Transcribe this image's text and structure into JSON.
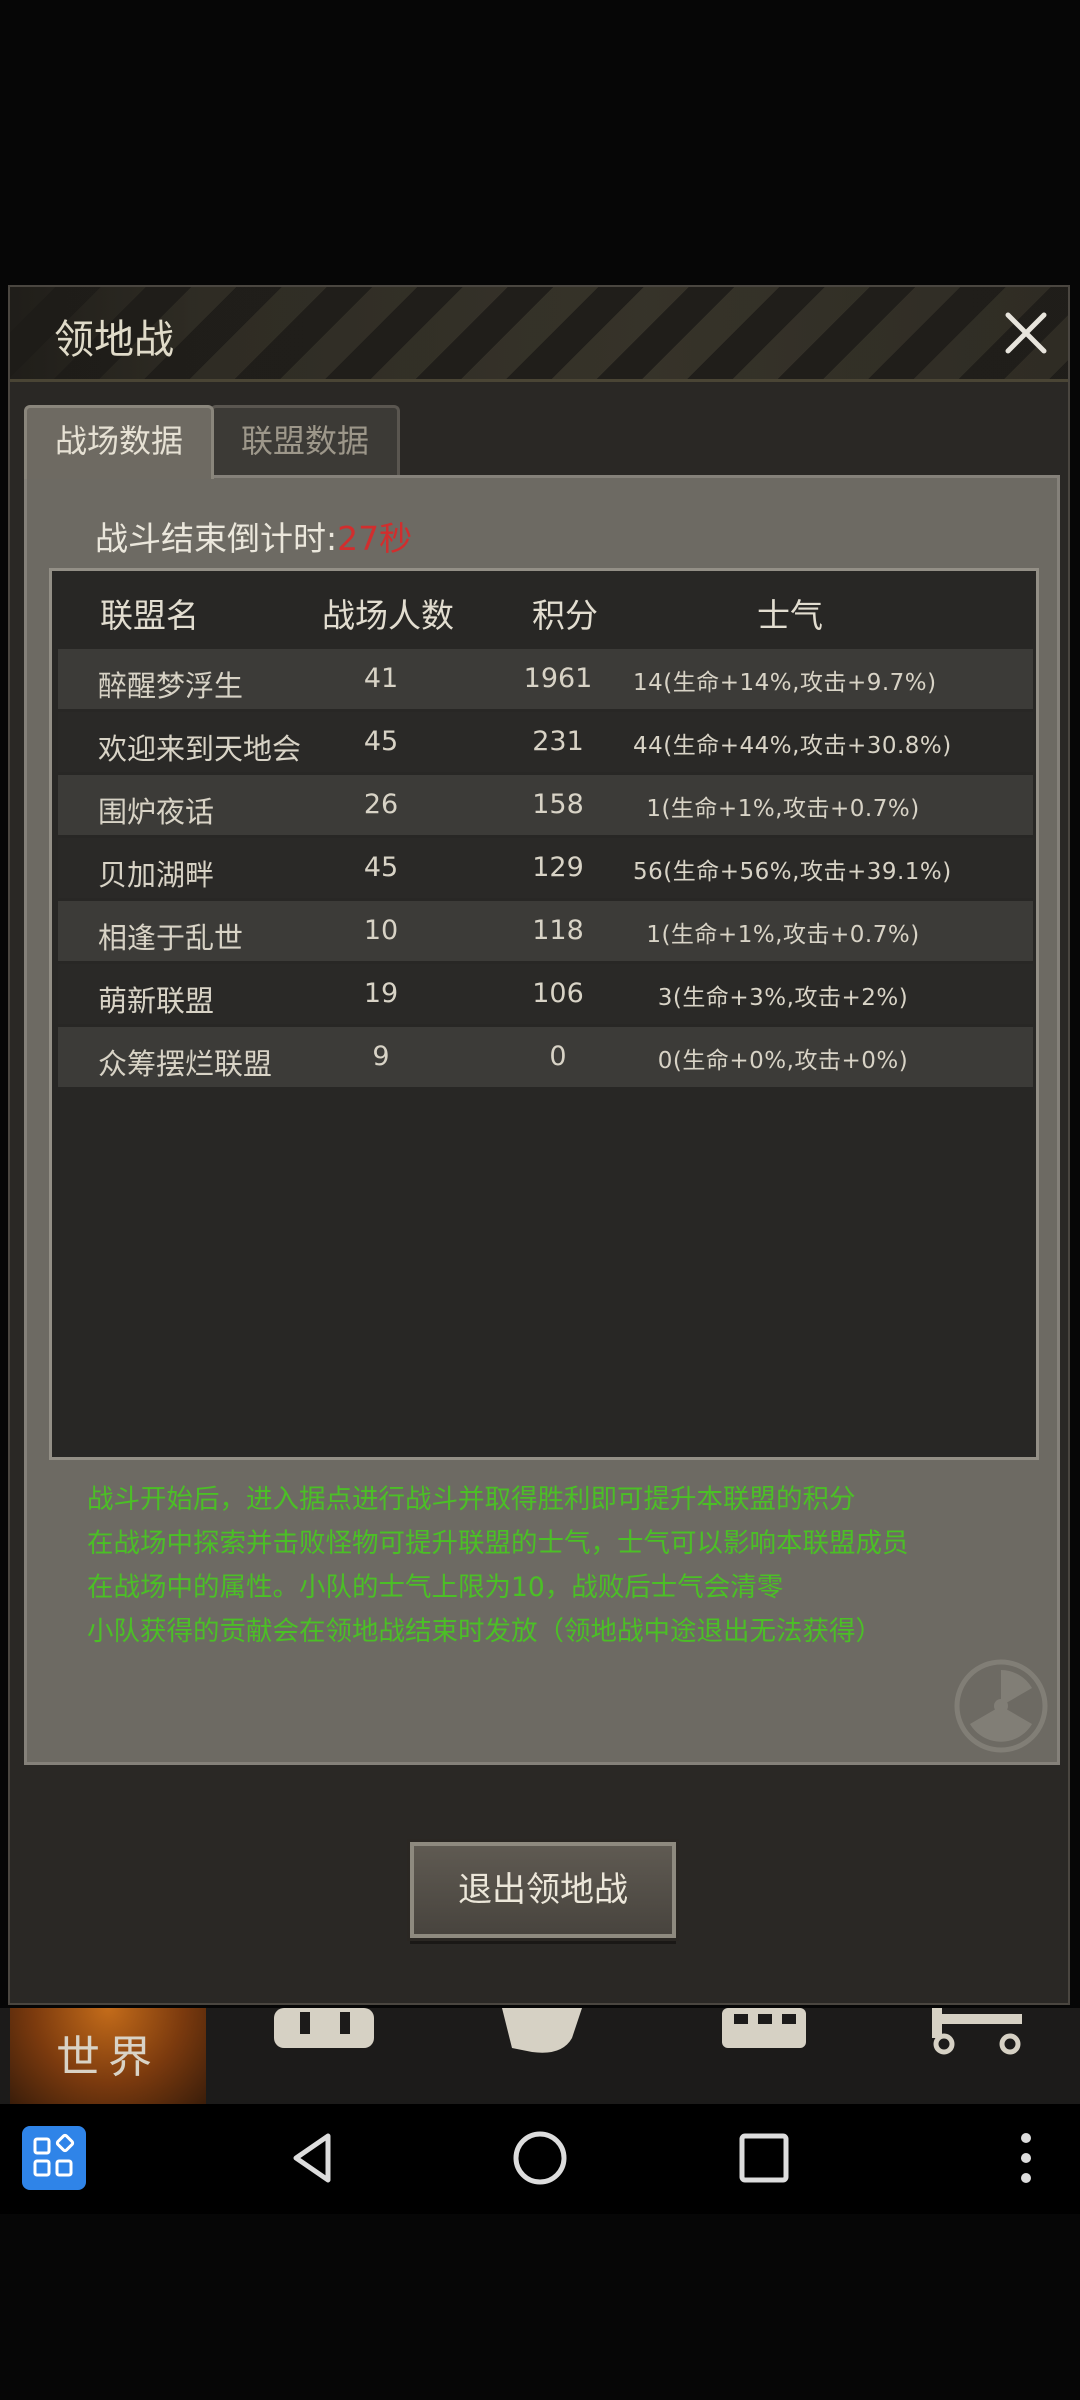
{
  "dialog": {
    "title": "领地战",
    "close_icon": "close-icon",
    "tabs": [
      {
        "label": "战场数据",
        "active": true
      },
      {
        "label": "联盟数据",
        "active": false
      }
    ],
    "countdown": {
      "label": "战斗结束倒计时:",
      "value": "27秒"
    },
    "table": {
      "headers": [
        "联盟名",
        "战场人数",
        "积分",
        "士气"
      ],
      "rows": [
        {
          "name": "醉醒梦浮生",
          "people": "41",
          "score": "1961",
          "morale": "14(生命+14%,攻击+9.7%)"
        },
        {
          "name": "欢迎来到天地会",
          "people": "45",
          "score": "231",
          "morale": "44(生命+44%,攻击+30.8%)"
        },
        {
          "name": "围炉夜话",
          "people": "26",
          "score": "158",
          "morale": "1(生命+1%,攻击+0.7%)"
        },
        {
          "name": "贝加湖畔",
          "people": "45",
          "score": "129",
          "morale": "56(生命+56%,攻击+39.1%)"
        },
        {
          "name": "相逢于乱世",
          "people": "10",
          "score": "118",
          "morale": "1(生命+1%,攻击+0.7%)"
        },
        {
          "name": "萌新联盟",
          "people": "19",
          "score": "106",
          "morale": "3(生命+3%,攻击+2%)"
        },
        {
          "name": "众筹摆烂联盟",
          "people": "9",
          "score": "0",
          "morale": "0(生命+0%,攻击+0%)"
        }
      ]
    },
    "notes": [
      "战斗开始后，进入据点进行战斗并取得胜利即可提升本联盟的积分",
      "在战场中探索并击败怪物可提升联盟的士气，士气可以影响本联盟成员",
      "在战场中的属性。小队的士气上限为10，战败后士气会清零",
      "小队获得的贡献会在领地战结束时发放（领地战中途退出无法获得）"
    ],
    "exit_button": "退出领地战"
  },
  "bottom_nav": {
    "items": [
      {
        "label": "世界",
        "icon": "globe-icon",
        "active": true
      },
      {
        "label": "",
        "icon": "backpack-icon"
      },
      {
        "label": "",
        "icon": "character-icon"
      },
      {
        "label": "",
        "icon": "building-icon"
      },
      {
        "label": "",
        "icon": "vehicle-icon"
      }
    ]
  },
  "system_nav": {
    "apps": "apps-icon",
    "back": "back-icon",
    "home": "home-icon",
    "recents": "recents-icon",
    "more": "more-icon"
  },
  "colors": {
    "notes_text": "#4bbf26",
    "countdown_value": "#d12e2e",
    "dialog_bg": "#2a2825",
    "panel_bg": "#6d6a63"
  }
}
